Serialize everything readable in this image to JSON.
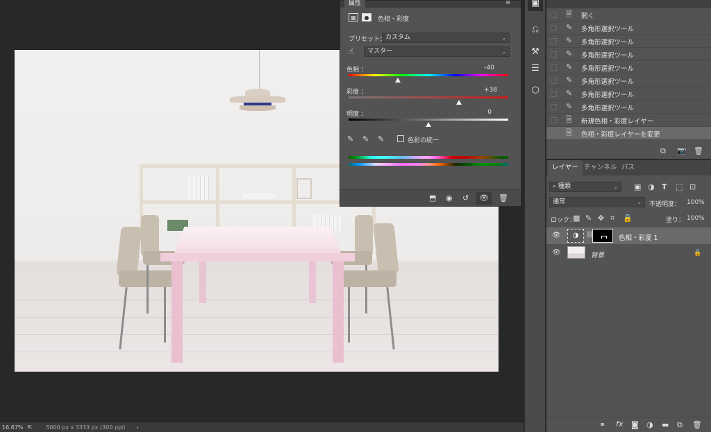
{
  "properties": {
    "tab_label": "属性",
    "panel_title": "色相・彩度",
    "preset_label": "プリセット：",
    "preset_value": "カスタム",
    "channel_value": "マスター",
    "hue_label": "色相 ：",
    "hue_value": "-40",
    "hue_fraction": 0.31,
    "saturation_label": "彩度 ：",
    "saturation_value": "+38",
    "saturation_fraction": 0.69,
    "lightness_label": "明度 ：",
    "lightness_value": "0",
    "lightness_fraction": 0.5,
    "colorize_label": "色彩の統一",
    "colorize_checked": false
  },
  "history": {
    "items": [
      {
        "icon": "document-icon",
        "label": "開く",
        "selected": false
      },
      {
        "icon": "brush-icon",
        "label": "多角形選択ツール",
        "selected": false
      },
      {
        "icon": "brush-icon",
        "label": "多角形選択ツール",
        "selected": false
      },
      {
        "icon": "brush-icon",
        "label": "多角形選択ツール",
        "selected": false
      },
      {
        "icon": "brush-icon",
        "label": "多角形選択ツール",
        "selected": false
      },
      {
        "icon": "brush-icon",
        "label": "多角形選択ツール",
        "selected": false
      },
      {
        "icon": "brush-icon",
        "label": "多角形選択ツール",
        "selected": false
      },
      {
        "icon": "brush-icon",
        "label": "多角形選択ツール",
        "selected": false
      },
      {
        "icon": "document-icon",
        "label": "新規色相・彩度レイヤー",
        "selected": false
      },
      {
        "icon": "document-icon",
        "label": "色相・彩度レイヤーを変更",
        "selected": true
      }
    ]
  },
  "layers": {
    "tabs": [
      "レイヤー",
      "チャンネル",
      "パス"
    ],
    "filter_label": "種類",
    "blend_mode": "通常",
    "opacity_label": "不透明度：",
    "opacity_value": "100%",
    "lock_label": "ロック：",
    "fill_label": "塗り：",
    "fill_value": "100%",
    "items": [
      {
        "name": "色相・彩度 1",
        "selected": true
      },
      {
        "name": "背景",
        "selected": false
      }
    ]
  },
  "status": {
    "zoom": "16.67%",
    "doc_info": "5000 px x 3333 px (300 ppi)"
  },
  "colors": {
    "panel": "#535353",
    "selected_row": "#6a6a6a",
    "canvas_bg": "#282828"
  }
}
